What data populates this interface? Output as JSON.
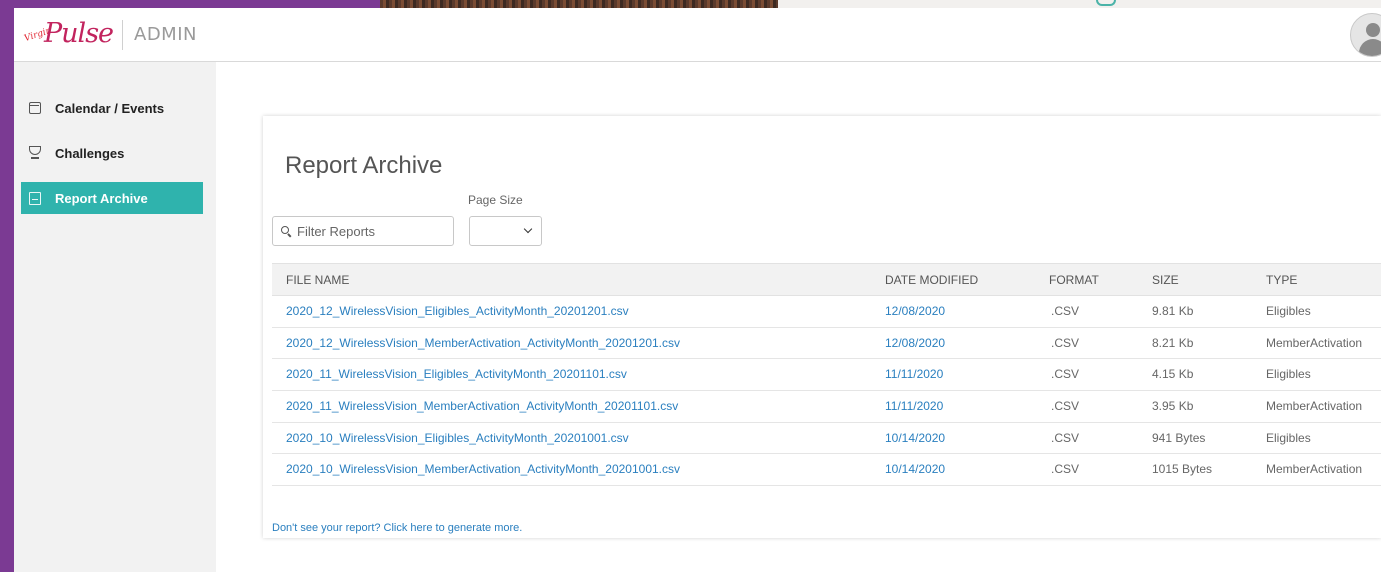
{
  "header": {
    "logo_small": "Virgin",
    "logo_main": "Pulse",
    "section": "ADMIN"
  },
  "sidebar": {
    "items": [
      {
        "label": "Calendar / Events",
        "icon": "calendar-icon",
        "active": false
      },
      {
        "label": "Challenges",
        "icon": "trophy-icon",
        "active": false
      },
      {
        "label": "Report Archive",
        "icon": "report-icon",
        "active": true
      }
    ]
  },
  "main": {
    "title": "Report Archive",
    "filter": {
      "placeholder": "Filter Reports",
      "value": ""
    },
    "page_size": {
      "label": "Page Size",
      "value": ""
    },
    "columns": [
      "FILE NAME",
      "DATE MODIFIED",
      "FORMAT",
      "SIZE",
      "TYPE"
    ],
    "rows": [
      {
        "file": "2020_12_WirelessVision_Eligibles_ActivityMonth_20201201.csv",
        "date": "12/08/2020",
        "format": ".CSV",
        "size": "9.81 Kb",
        "type": "Eligibles"
      },
      {
        "file": "2020_12_WirelessVision_MemberActivation_ActivityMonth_20201201.csv",
        "date": "12/08/2020",
        "format": ".CSV",
        "size": "8.21 Kb",
        "type": "MemberActivation"
      },
      {
        "file": "2020_11_WirelessVision_Eligibles_ActivityMonth_20201101.csv",
        "date": "11/11/2020",
        "format": ".CSV",
        "size": "4.15 Kb",
        "type": "Eligibles"
      },
      {
        "file": "2020_11_WirelessVision_MemberActivation_ActivityMonth_20201101.csv",
        "date": "11/11/2020",
        "format": ".CSV",
        "size": "3.95 Kb",
        "type": "MemberActivation"
      },
      {
        "file": "2020_10_WirelessVision_Eligibles_ActivityMonth_20201001.csv",
        "date": "10/14/2020",
        "format": ".CSV",
        "size": "941 Bytes",
        "type": "Eligibles"
      },
      {
        "file": "2020_10_WirelessVision_MemberActivation_ActivityMonth_20201001.csv",
        "date": "10/14/2020",
        "format": ".CSV",
        "size": "1015 Bytes",
        "type": "MemberActivation"
      }
    ],
    "footer_link": "Don't see your report? Click here to generate more."
  },
  "colors": {
    "accent": "#2fb3ad",
    "link": "#2a7fbf",
    "brand": "#c2245e",
    "backdrop": "#7b3a93"
  }
}
